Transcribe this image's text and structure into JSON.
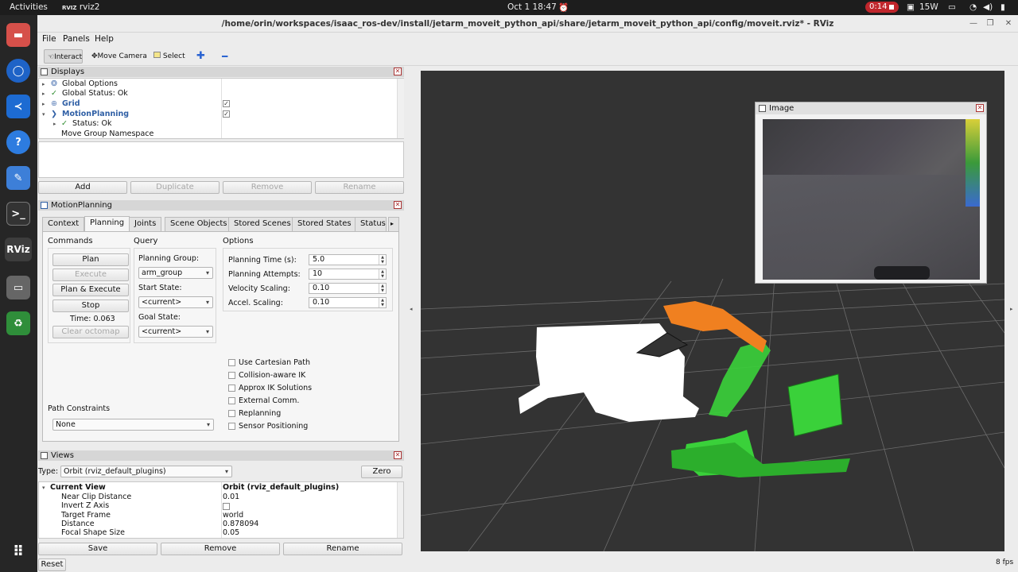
{
  "topbar": {
    "activities": "Activities",
    "app_name": "rviz2",
    "datetime": "Oct 1  18:47",
    "recording_time": "0:14",
    "power": "15W"
  },
  "window": {
    "title": "/home/orin/workspaces/isaac_ros-dev/install/jetarm_moveit_python_api/share/jetarm_moveit_python_api/config/moveit.rviz* - RViz"
  },
  "menu": {
    "file": "File",
    "panels": "Panels",
    "help": "Help"
  },
  "toolbar": {
    "interact": "Interact",
    "move_camera": "Move Camera",
    "select": "Select"
  },
  "displays": {
    "header": "Displays",
    "items": [
      {
        "label": "Global Options",
        "check": ""
      },
      {
        "label": "Global Status: Ok",
        "check": ""
      },
      {
        "label": "Grid",
        "check": "✓"
      },
      {
        "label": "MotionPlanning",
        "check": "✓"
      },
      {
        "label": "Status: Ok",
        "check": ""
      },
      {
        "label": "Move Group Namespace",
        "check": ""
      }
    ],
    "buttons": {
      "add": "Add",
      "duplicate": "Duplicate",
      "remove": "Remove",
      "rename": "Rename"
    }
  },
  "motion": {
    "header": "MotionPlanning",
    "tabs": [
      "Context",
      "Planning",
      "Joints",
      "Scene Objects",
      "Stored Scenes",
      "Stored States",
      "Status"
    ],
    "commands_label": "Commands",
    "query_label": "Query",
    "options_label": "Options",
    "plan": "Plan",
    "execute": "Execute",
    "plan_execute": "Plan & Execute",
    "stop": "Stop",
    "time": "Time: 0.063",
    "clear_octomap": "Clear octomap",
    "planning_group_label": "Planning Group:",
    "planning_group": "arm_group",
    "start_state_label": "Start State:",
    "start_state": "<current>",
    "goal_state_label": "Goal State:",
    "goal_state": "<current>",
    "planning_time_label": "Planning Time (s):",
    "planning_time": "5.0",
    "planning_attempts_label": "Planning Attempts:",
    "planning_attempts": "10",
    "velocity_label": "Velocity Scaling:",
    "velocity": "0.10",
    "accel_label": "Accel. Scaling:",
    "accel": "0.10",
    "checkboxes": [
      "Use Cartesian Path",
      "Collision-aware IK",
      "Approx IK Solutions",
      "External Comm.",
      "Replanning",
      "Sensor Positioning"
    ],
    "path_constraints_label": "Path Constraints",
    "path_constraints": "None"
  },
  "views": {
    "header": "Views",
    "type_label": "Type:",
    "type": "Orbit (rviz_default_plugins)",
    "zero": "Zero",
    "current_view": "Current View",
    "current_view_value": "Orbit (rviz_default_plugins)",
    "props": [
      {
        "name": "Near Clip Distance",
        "value": "0.01"
      },
      {
        "name": "Invert Z Axis",
        "value": ""
      },
      {
        "name": "Target Frame",
        "value": "world"
      },
      {
        "name": "Distance",
        "value": "0.878094"
      },
      {
        "name": "Focal Shape Size",
        "value": "0.05"
      }
    ],
    "save": "Save",
    "remove": "Remove",
    "rename": "Rename"
  },
  "image_panel": {
    "title": "Image"
  },
  "status": {
    "reset": "Reset",
    "fps": "8 fps"
  }
}
